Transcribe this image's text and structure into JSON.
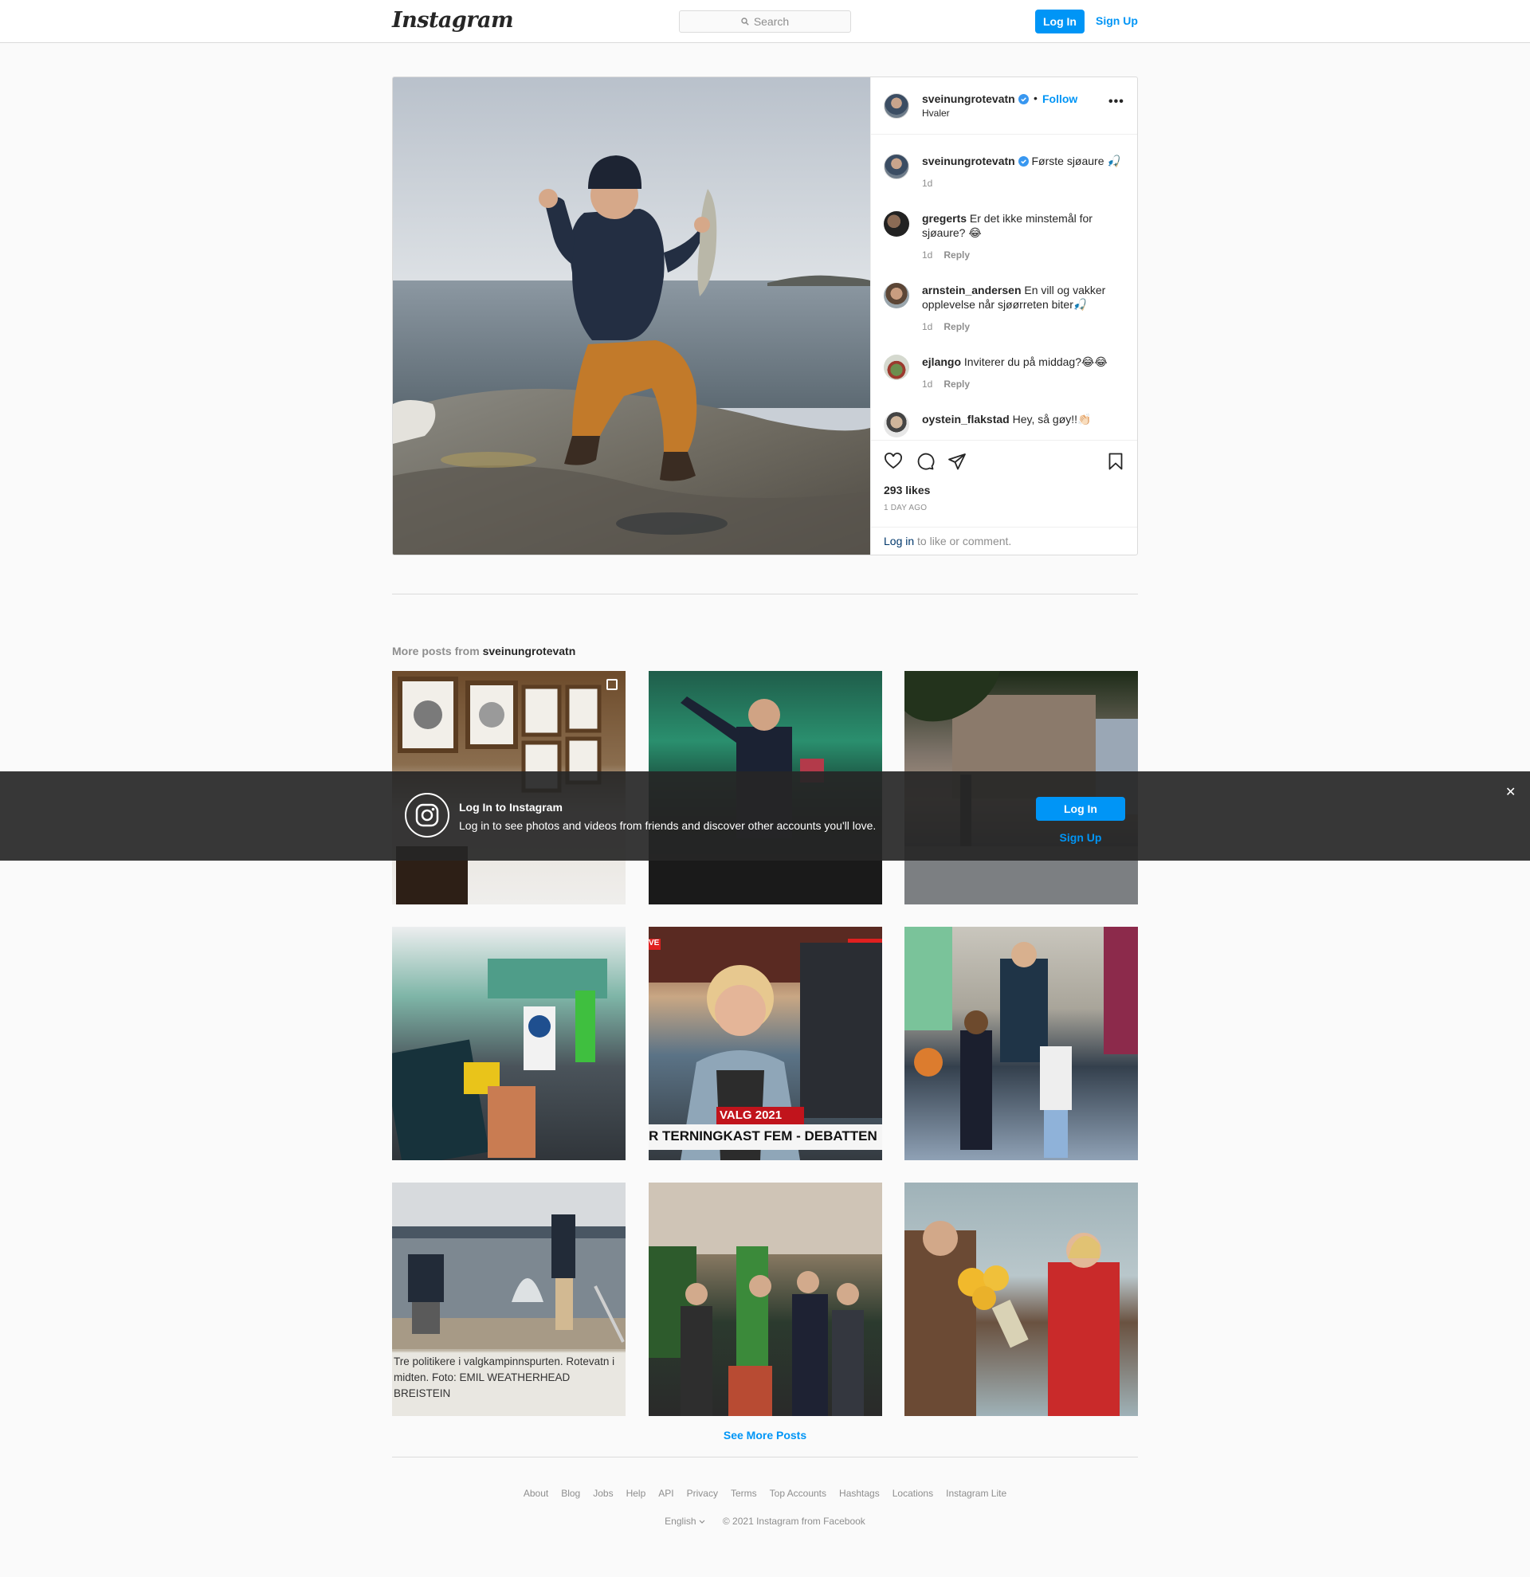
{
  "header": {
    "logo": "Instagram",
    "search_placeholder": "Search",
    "login_label": "Log In",
    "signup_label": "Sign Up"
  },
  "post": {
    "username": "sveinungrotevatn",
    "separator": "•",
    "follow_label": "Follow",
    "location": "Hvaler",
    "more_label": "•••",
    "caption": {
      "username": "sveinungrotevatn",
      "text": "Første sjøaure 🎣",
      "time": "1d"
    },
    "comments": [
      {
        "username": "gregerts",
        "text": "Er det ikke minstemål for sjøaure? 😂",
        "time": "1d",
        "reply": "Reply"
      },
      {
        "username": "arnstein_andersen",
        "text": "En vill og vakker opplevelse når sjøørreten biter🎣",
        "time": "1d",
        "reply": "Reply"
      },
      {
        "username": "ejlango",
        "text": "Inviterer du på middag?😂😂",
        "time": "1d",
        "reply": "Reply"
      },
      {
        "username": "oystein_flakstad",
        "text": "Hey, så gøy!!👏🏻",
        "time": "",
        "reply": ""
      }
    ],
    "likes": "293 likes",
    "time_ago": "1 DAY AGO",
    "login_link": "Log in",
    "login_rest": " to like or comment."
  },
  "more_posts": {
    "prefix": "More posts from ",
    "username": "sveinungrotevatn",
    "thumb7_caption": "Tre politikere i valgkampinnspurten. Rotevatn i midten. Foto: EMIL WEATHERHEAD BREISTEIN",
    "thumb5_banner": "VALG 2021",
    "thumb5_ticker": "R TERNINGKAST FEM - DEBATTEN",
    "thumb5_live": "VE",
    "see_more": "See More Posts"
  },
  "footer": {
    "links": [
      "About",
      "Blog",
      "Jobs",
      "Help",
      "API",
      "Privacy",
      "Terms",
      "Top Accounts",
      "Hashtags",
      "Locations",
      "Instagram Lite"
    ],
    "language": "English",
    "copyright": "© 2021 Instagram from Facebook"
  },
  "banner": {
    "title": "Log In to Instagram",
    "subtitle": "Log in to see photos and videos from friends and discover other accounts you'll love.",
    "login_label": "Log In",
    "signup_label": "Sign Up",
    "close_label": "✕"
  },
  "colors": {
    "accent": "#0095f6",
    "link_dark": "#00376b",
    "muted": "#8e8e8e",
    "border": "#dbdbdb"
  },
  "icons": [
    "search-icon",
    "verified-badge-icon",
    "more-options-icon",
    "heart-icon",
    "comment-icon",
    "share-icon",
    "bookmark-icon",
    "multiple-posts-icon",
    "instagram-camera-icon",
    "close-icon",
    "chevron-down-icon"
  ]
}
